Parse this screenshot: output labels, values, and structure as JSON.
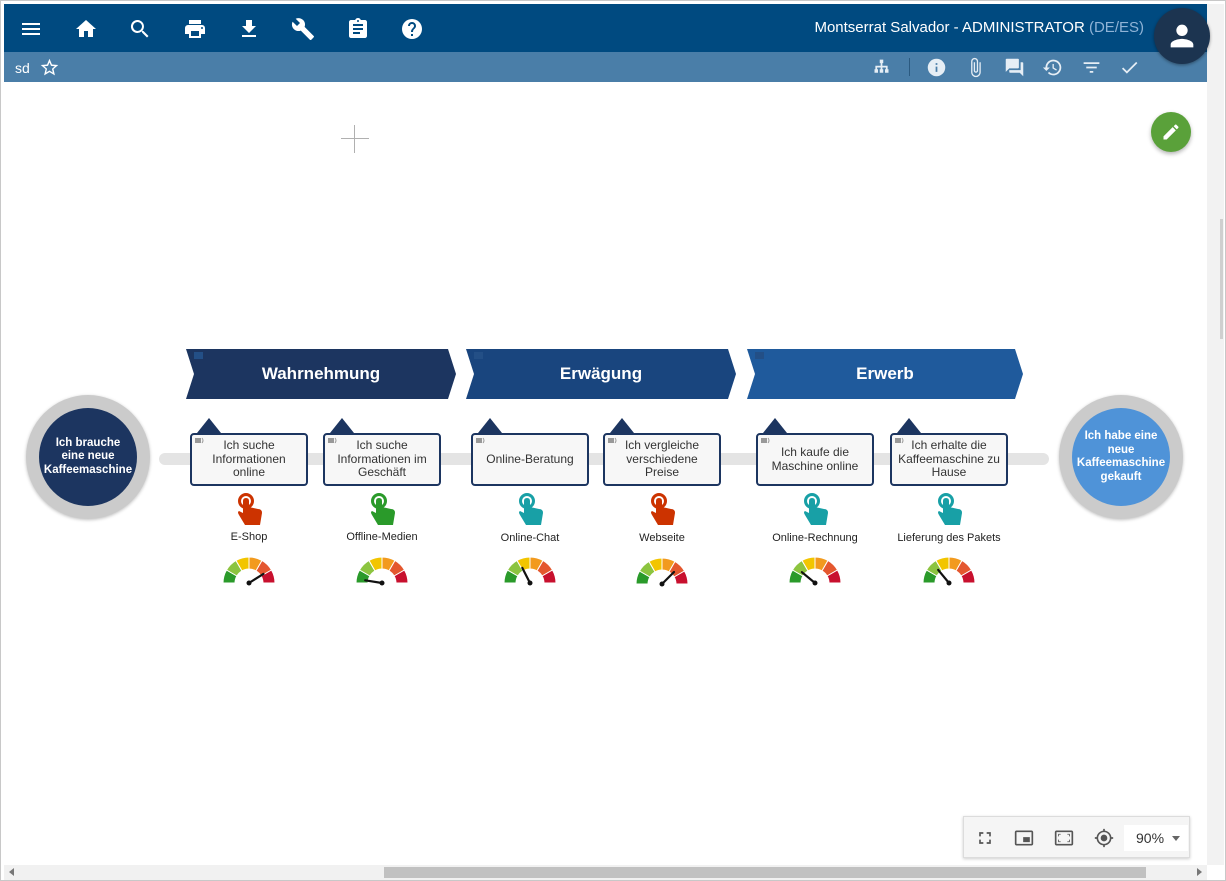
{
  "header": {
    "user_name": "Montserrat Salvador - ADMINISTRATOR",
    "locale": "(DE/ES)",
    "icons": [
      "menu-icon",
      "home-icon",
      "search-icon",
      "print-icon",
      "download-icon",
      "wrench-icon",
      "clipboard-icon",
      "help-icon"
    ]
  },
  "subbar": {
    "doc_name": "sd",
    "icons": [
      "star-icon",
      "sitemap-icon",
      "info-icon",
      "attachment-icon",
      "comments-icon",
      "history-icon",
      "filter-icon",
      "check-icon"
    ]
  },
  "journey": {
    "start": "Ich brauche eine neue Kaffeemaschine",
    "end": "Ich habe eine neue Kaffeemaschine gekauft",
    "phases": [
      {
        "label": "Wahrnehmung",
        "color": "#1c3560"
      },
      {
        "label": "Erwägung",
        "color": "#19457e"
      },
      {
        "label": "Erwerb",
        "color": "#1f5a9c"
      }
    ],
    "steps": [
      {
        "text": "Ich suche Informationen online",
        "touchpoint": "E-Shop",
        "touch_color": "#cc3300",
        "gauge_value": 0.82
      },
      {
        "text": "Ich suche Informationen im Geschäft",
        "touchpoint": "Offline-Medien",
        "touch_color": "#2a9a2a",
        "gauge_value": 0.05
      },
      {
        "text": "Online-Beratung",
        "touchpoint": "Online-Chat",
        "touch_color": "#18a0a6",
        "gauge_value": 0.35
      },
      {
        "text": "Ich vergleiche verschiedene Preise",
        "touchpoint": "Webseite",
        "touch_color": "#cc3300",
        "gauge_value": 0.75
      },
      {
        "text": "Ich kaufe die Maschine online",
        "touchpoint": "Online-Rechnung",
        "touch_color": "#18a0a6",
        "gauge_value": 0.22
      },
      {
        "text": "Ich erhalte die Kaffeemaschine zu Hause",
        "touchpoint": "Lieferung des Pakets",
        "touch_color": "#18a0a6",
        "gauge_value": 0.28
      }
    ],
    "start_color": "#1c3560",
    "end_color": "#4f93d8"
  },
  "zoom": {
    "value": "90%",
    "icons": [
      "fullscreen-icon",
      "picture-in-picture-icon",
      "fit-screen-icon",
      "locate-icon"
    ]
  }
}
